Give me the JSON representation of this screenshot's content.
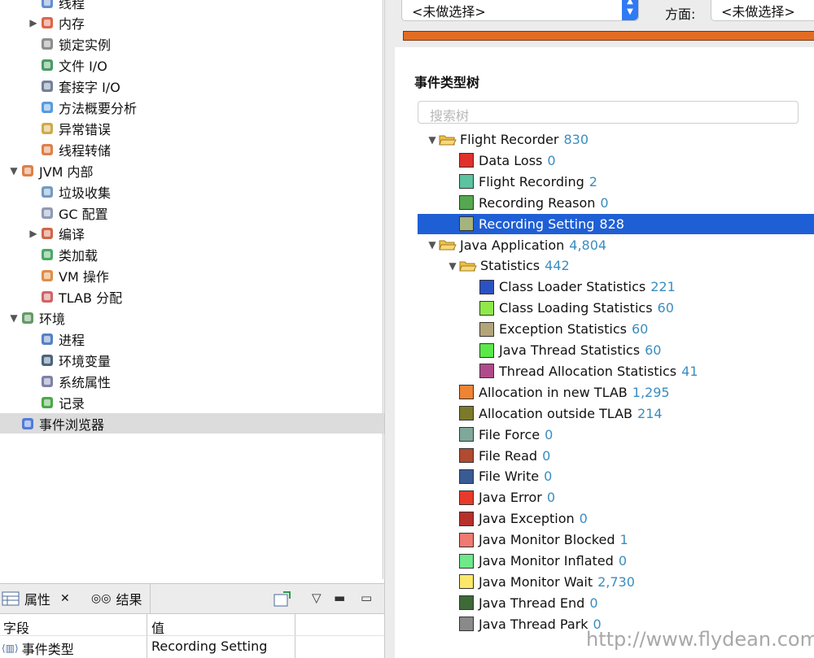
{
  "left_nav": {
    "items": [
      {
        "label": "线程",
        "icon": "thread-icon",
        "indent": 1,
        "toggle": ""
      },
      {
        "label": "内存",
        "icon": "memory-icon",
        "indent": 1,
        "toggle": "▶"
      },
      {
        "label": "锁定实例",
        "icon": "lock-instances-icon",
        "indent": 1,
        "toggle": ""
      },
      {
        "label": "文件 I/O",
        "icon": "file-io-icon",
        "indent": 1,
        "toggle": ""
      },
      {
        "label": "套接字 I/O",
        "icon": "socket-io-icon",
        "indent": 1,
        "toggle": ""
      },
      {
        "label": "方法概要分析",
        "icon": "method-profiling-icon",
        "indent": 1,
        "toggle": ""
      },
      {
        "label": "异常错误",
        "icon": "exception-icon",
        "indent": 1,
        "toggle": ""
      },
      {
        "label": "线程转储",
        "icon": "thread-dump-icon",
        "indent": 1,
        "toggle": ""
      },
      {
        "label": "JVM 内部",
        "icon": "jvm-internals-icon",
        "indent": 0,
        "toggle": "▼"
      },
      {
        "label": "垃圾收集",
        "icon": "garbage-collection-icon",
        "indent": 1,
        "toggle": ""
      },
      {
        "label": "GC 配置",
        "icon": "gc-config-icon",
        "indent": 1,
        "toggle": ""
      },
      {
        "label": "编译",
        "icon": "compilation-icon",
        "indent": 1,
        "toggle": "▶"
      },
      {
        "label": "类加载",
        "icon": "class-loading-icon",
        "indent": 1,
        "toggle": ""
      },
      {
        "label": "VM 操作",
        "icon": "vm-operations-icon",
        "indent": 1,
        "toggle": ""
      },
      {
        "label": "TLAB 分配",
        "icon": "tlab-icon",
        "indent": 1,
        "toggle": ""
      },
      {
        "label": "环境",
        "icon": "environment-icon",
        "indent": 0,
        "toggle": "▼"
      },
      {
        "label": "进程",
        "icon": "process-icon",
        "indent": 1,
        "toggle": ""
      },
      {
        "label": "环境变量",
        "icon": "env-variables-icon",
        "indent": 1,
        "toggle": ""
      },
      {
        "label": "系统属性",
        "icon": "system-properties-icon",
        "indent": 1,
        "toggle": ""
      },
      {
        "label": "记录",
        "icon": "recording-icon",
        "indent": 1,
        "toggle": ""
      },
      {
        "label": "事件浏览器",
        "icon": "event-browser-icon",
        "indent": 0,
        "toggle": "",
        "selected": true
      }
    ]
  },
  "filter_bar": {
    "select1_value": "<未做选择>",
    "facet_label": "方面:",
    "select2_value": "<未做选择>"
  },
  "event_tree": {
    "title": "事件类型树",
    "search_placeholder": "搜索树",
    "rows": [
      {
        "type": "folder",
        "label": "Flight Recorder",
        "count": "830",
        "level": 0,
        "toggle": "▼"
      },
      {
        "type": "leaf",
        "label": "Data Loss",
        "count": "0",
        "level": 1,
        "color": "#e0312c"
      },
      {
        "type": "leaf",
        "label": "Flight Recording",
        "count": "2",
        "level": 1,
        "color": "#5cc4a0"
      },
      {
        "type": "leaf",
        "label": "Recording Reason",
        "count": "0",
        "level": 1,
        "color": "#55a84f"
      },
      {
        "type": "leaf",
        "label": "Recording Setting",
        "count": "828",
        "level": 1,
        "color": "#a4b47c",
        "selected": true
      },
      {
        "type": "folder",
        "label": "Java Application",
        "count": "4,804",
        "level": 0,
        "toggle": "▼"
      },
      {
        "type": "folder",
        "label": "Statistics",
        "count": "442",
        "level": 1,
        "toggle": "▼"
      },
      {
        "type": "leaf",
        "label": "Class Loader Statistics",
        "count": "221",
        "level": 2,
        "color": "#2a52c2"
      },
      {
        "type": "leaf",
        "label": "Class Loading Statistics",
        "count": "60",
        "level": 2,
        "color": "#8fe84a"
      },
      {
        "type": "leaf",
        "label": "Exception Statistics",
        "count": "60",
        "level": 2,
        "color": "#b3a57a"
      },
      {
        "type": "leaf",
        "label": "Java Thread Statistics",
        "count": "60",
        "level": 2,
        "color": "#5ae84a"
      },
      {
        "type": "leaf",
        "label": "Thread Allocation Statistics",
        "count": "41",
        "level": 2,
        "color": "#b04a8a"
      },
      {
        "type": "leaf",
        "label": "Allocation in new TLAB",
        "count": "1,295",
        "level": 1,
        "color": "#ee8434"
      },
      {
        "type": "leaf",
        "label": "Allocation outside TLAB",
        "count": "214",
        "level": 1,
        "color": "#7a7a2a"
      },
      {
        "type": "leaf",
        "label": "File Force",
        "count": "0",
        "level": 1,
        "color": "#7fa89a"
      },
      {
        "type": "leaf",
        "label": "File Read",
        "count": "0",
        "level": 1,
        "color": "#b04a30"
      },
      {
        "type": "leaf",
        "label": "File Write",
        "count": "0",
        "level": 1,
        "color": "#3a5a94"
      },
      {
        "type": "leaf",
        "label": "Java Error",
        "count": "0",
        "level": 1,
        "color": "#e83a2a"
      },
      {
        "type": "leaf",
        "label": "Java Exception",
        "count": "0",
        "level": 1,
        "color": "#b8302a"
      },
      {
        "type": "leaf",
        "label": "Java Monitor Blocked",
        "count": "1",
        "level": 1,
        "color": "#ef7a72"
      },
      {
        "type": "leaf",
        "label": "Java Monitor Inflated",
        "count": "0",
        "level": 1,
        "color": "#6ee88a"
      },
      {
        "type": "leaf",
        "label": "Java Monitor Wait",
        "count": "2,730",
        "level": 1,
        "color": "#fbe86a"
      },
      {
        "type": "leaf",
        "label": "Java Thread End",
        "count": "0",
        "level": 1,
        "color": "#3e6a38"
      },
      {
        "type": "leaf",
        "label": "Java Thread Park",
        "count": "0",
        "level": 1,
        "color": "#8a8a8a"
      }
    ]
  },
  "bottom_panel": {
    "tab_properties": "属性",
    "tab_results": "结果",
    "col_field": "字段",
    "col_value": "值",
    "row_field": "事件类型",
    "row_value": "Recording Setting"
  },
  "watermark": "http://www.flydean.com"
}
